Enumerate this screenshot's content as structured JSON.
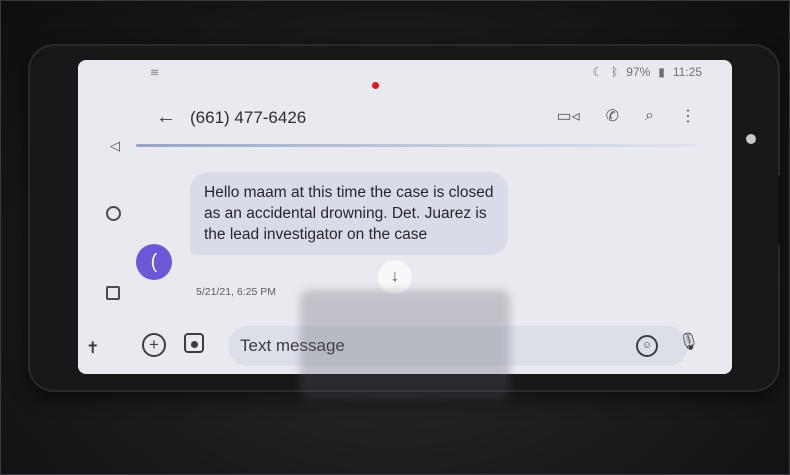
{
  "status_bar": {
    "battery": "97%",
    "time": "11:25",
    "icons": [
      "wifi-icon",
      "nfc-icon",
      "bluetooth-icon",
      "battery-icon"
    ]
  },
  "conversation": {
    "contact_number": "(661) 477-6426",
    "actions": [
      "video-call-icon",
      "phone-icon",
      "search-icon",
      "more-vert-icon"
    ]
  },
  "message": {
    "avatar_initial": "(",
    "text": "Hello maam at this time the case is closed as an accidental drowning. Det. Juarez is the lead investigator on the case",
    "timestamp": "5/21/21, 6:25 PM"
  },
  "composer": {
    "placeholder": "Text message"
  },
  "colors": {
    "avatar": "#6b57d8",
    "bubble": "#d9dbe6",
    "screen": "#e9eaf0",
    "record_dot": "#e6141a"
  }
}
